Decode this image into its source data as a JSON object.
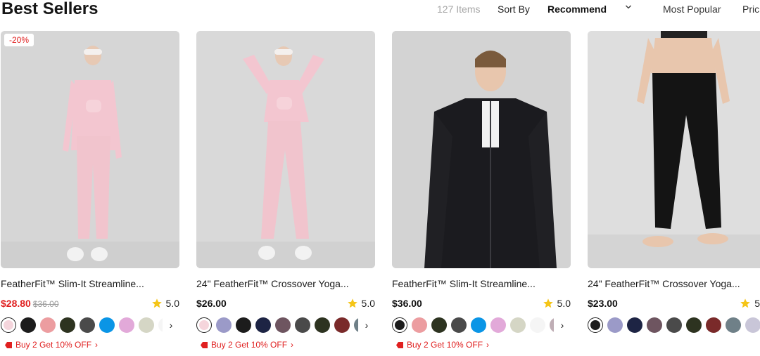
{
  "header": {
    "title": "Best Sellers",
    "item_count": "127 Items",
    "sort_by_label": "Sort By",
    "sort_selected": "Recommend",
    "most_popular": "Most Popular",
    "price_label": "Pric"
  },
  "products": [
    {
      "name": "FeatherFit™ Slim-It Streamline...",
      "price": "$28.80",
      "original_price": "$36.00",
      "discount_badge": "-20%",
      "rating": "5.0",
      "promo": "Buy 2 Get 10% OFF",
      "image_bg": "#d6d6d6",
      "swatches": [
        "#f5d5dc",
        "#1c1c1c",
        "#ec9da0",
        "#2d3320",
        "#4a4a4a",
        "#0a95e6",
        "#e2a9d9",
        "#d5d6c5",
        "#f5f5f5"
      ]
    },
    {
      "name": "24\" FeatherFit™ Crossover Yoga...",
      "price": "$26.00",
      "original_price": "",
      "discount_badge": "",
      "rating": "5.0",
      "promo": "Buy 2 Get 10% OFF",
      "image_bg": "#d9d9d9",
      "swatches": [
        "#f5d5dc",
        "#9b9ac8",
        "#1c1c1c",
        "#1d2444",
        "#6e5560",
        "#4a4a4a",
        "#2d3320",
        "#7a2a2a",
        "#6f8088"
      ]
    },
    {
      "name": "FeatherFit™ Slim-It Streamline...",
      "price": "$36.00",
      "original_price": "",
      "discount_badge": "",
      "rating": "5.0",
      "promo": "Buy 2 Get 10% OFF",
      "image_bg": "#d3d3d3",
      "swatches": [
        "#1c1c1c",
        "#ec9da0",
        "#2d3320",
        "#4a4a4a",
        "#0a95e6",
        "#e2a9d9",
        "#d5d6c5",
        "#f5f5f5",
        "#bfaeb5"
      ]
    },
    {
      "name": "24\" FeatherFit™ Crossover Yoga...",
      "price": "$23.00",
      "original_price": "",
      "discount_badge": "",
      "rating": "5",
      "promo": "",
      "image_bg": "#dedede",
      "swatches": [
        "#1c1c1c",
        "#9b9ac8",
        "#1d2444",
        "#6e5560",
        "#4a4a4a",
        "#2d3320",
        "#7a2a2a",
        "#6f8088",
        "#c9c6d8"
      ]
    }
  ],
  "colors": {
    "sale_red": "#e02020",
    "star_yellow": "#f5c518",
    "text_dark": "#111111",
    "muted": "#a6a6a6"
  },
  "icons": {
    "sort_chevron": "chevron-down-icon",
    "rating_star": "star-icon",
    "promo_tag": "tag-icon",
    "swatch_next": "chevron-right-icon"
  }
}
